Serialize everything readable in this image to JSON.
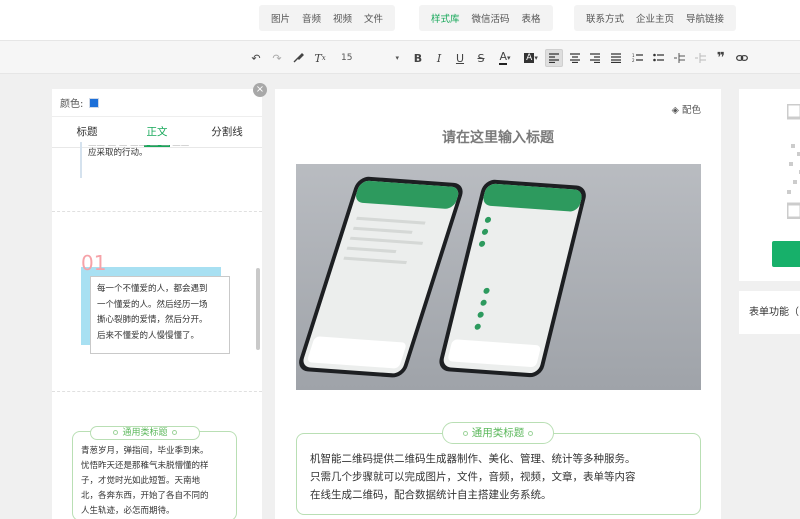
{
  "topbar": {
    "group1": [
      "图片",
      "音频",
      "视频",
      "文件"
    ],
    "group2": [
      "样式库",
      "微信活码",
      "表格"
    ],
    "group3": [
      "联系方式",
      "企业主页",
      "导航链接"
    ],
    "active": "样式库"
  },
  "toolbar": {
    "font_size": "15"
  },
  "leftpanel": {
    "color_label": "颜色:",
    "color_value": "#1c6fd8",
    "tabs": [
      "标题",
      "正文",
      "分割线"
    ],
    "active_tab": "正文",
    "tpl1_line1": "应采取的行动。",
    "tpl2_number": "01",
    "tpl2_lines": [
      "每一个不懂爱的人，都会遇到",
      "一个懂爱的人。然后经历一场",
      "撕心裂肺的爱情，然后分开。",
      "后来不懂爱的人慢慢懂了。"
    ],
    "tpl3_title": "通用类标题",
    "tpl3_lines": [
      "青葱岁月，弹指间，毕业季到来。",
      "忧悟昨天还是那稚气未脱懵懂的样",
      "子，才觉时光如此短暂。天南地",
      "北，各奔东西，开始了各自不同的",
      "人生轨迹，必怎而期待。"
    ]
  },
  "editor": {
    "color_button": "配色",
    "title": "请在这里输入标题",
    "box_title": "通用类标题",
    "box_lines": [
      "机智能二维码提供二维码生成器制作、美化、管理、统计等多种服务。",
      "只需几个步骤就可以完成图片，文件，音频，视频，文章，表单等内容",
      "在线生成二维码，配合数据统计自主搭建业务系统。"
    ]
  },
  "rightpanel": {
    "form_label": "表单功能（"
  }
}
